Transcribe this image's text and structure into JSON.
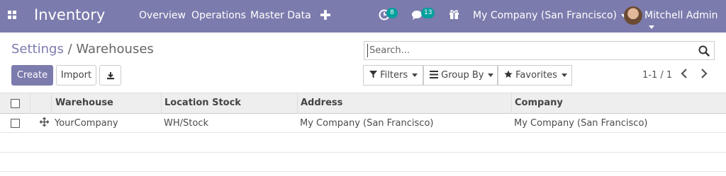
{
  "navbar": {
    "app_title": "Inventory",
    "menu": [
      "Overview",
      "Operations",
      "Master Data"
    ],
    "plus": "✚",
    "activity_badge": "8",
    "messages_badge": "13",
    "company": "My Company (San Francisco)",
    "user": "Mitchell Admin",
    "color": "#7c7bad"
  },
  "breadcrumb": {
    "parent": "Settings",
    "separator": "/",
    "current": "Warehouses"
  },
  "search": {
    "placeholder": "Search..."
  },
  "buttons": {
    "create": "Create",
    "import": "Import"
  },
  "filters": {
    "filters": "Filters",
    "group_by": "Group By",
    "favorites": "Favorites"
  },
  "pager": {
    "range": "1-1 / 1"
  },
  "table": {
    "columns": [
      "Warehouse",
      "Location Stock",
      "Address",
      "Company"
    ],
    "rows": [
      [
        "YourCompany",
        "WH/Stock",
        "My Company (San Francisco)",
        "My Company (San Francisco)"
      ]
    ]
  }
}
